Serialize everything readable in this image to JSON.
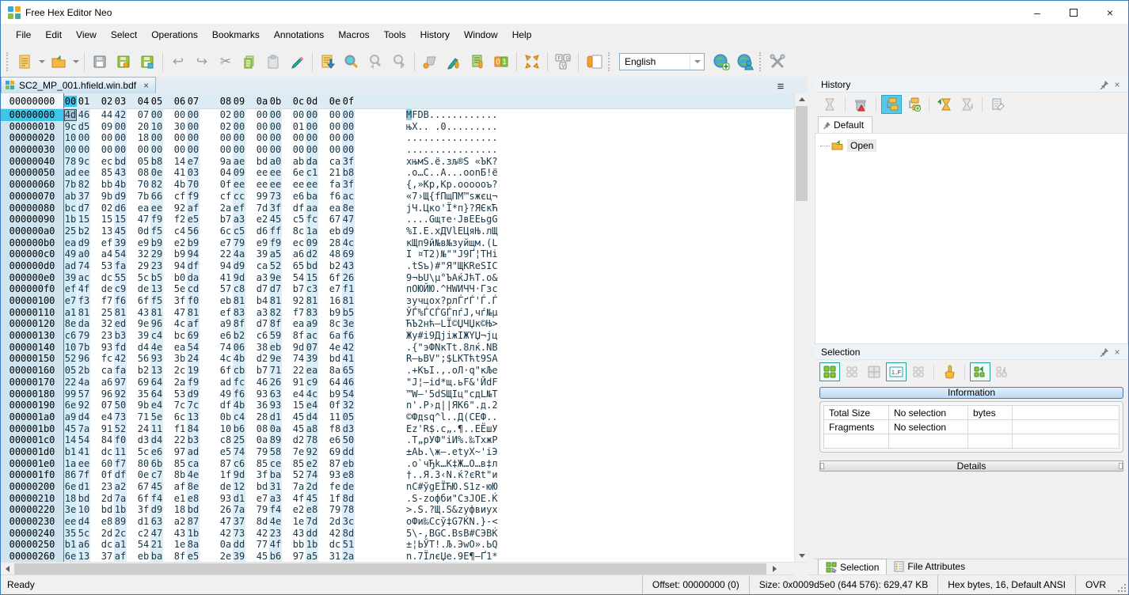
{
  "window": {
    "title": "Free Hex Editor Neo"
  },
  "menu": {
    "items": [
      {
        "label": "File"
      },
      {
        "label": "Edit"
      },
      {
        "label": "View"
      },
      {
        "label": "Select"
      },
      {
        "label": "Operations"
      },
      {
        "label": "Bookmarks"
      },
      {
        "label": "Annotations"
      },
      {
        "label": "Macros"
      },
      {
        "label": "Tools"
      },
      {
        "label": "History"
      },
      {
        "label": "Window"
      },
      {
        "label": "Help"
      }
    ]
  },
  "toolbar": {
    "language": "English"
  },
  "icons": {
    "hamburger": "≡",
    "close": "×",
    "undo": "↩",
    "redo": "↪",
    "cut": "✂",
    "minimize": "–"
  },
  "tab": {
    "title": "SC2_MP_001.hfield.win.bdf"
  },
  "hex": {
    "cursor": {
      "row": 0,
      "col": 0
    },
    "columns": [
      "00",
      "01",
      "02",
      "03",
      "04",
      "05",
      "06",
      "07",
      "08",
      "09",
      "0a",
      "0b",
      "0c",
      "0d",
      "0e",
      "0f"
    ],
    "header_addr": "00000000",
    "rows": [
      {
        "addr": "00000000",
        "bytes": "4d 46 44 42 07 00 00 00 02 00 00 00 00 00 00 00",
        "ascii": "MFDB............"
      },
      {
        "addr": "00000010",
        "bytes": "9c d5 09 00 20 10 30 00 02 00 00 00 01 00 00 00",
        "ascii": "њХ.. .0........."
      },
      {
        "addr": "00000020",
        "bytes": "10 00 00 00 18 00 00 00 00 00 00 00 00 00 00 00",
        "ascii": "................"
      },
      {
        "addr": "00000030",
        "bytes": "00 00 00 00 00 00 00 00 00 00 00 00 00 00 00 00",
        "ascii": "................"
      },
      {
        "addr": "00000040",
        "bytes": "78 9c ec bd 05 b8 14 e7 9a ae bd a0 ab da ca 3f",
        "ascii": "xњмЅ.ё.зљ®Ѕ «ЪК?"
      },
      {
        "addr": "00000050",
        "bytes": "ad ee 85 43 08 0e 41 03 04 09 ee ee 6e c1 21 b8",
        "ascii": ".о…C..A...ооnБ!ё"
      },
      {
        "addr": "00000060",
        "bytes": "7b 82 bb 4b 70 82 4b 70 0f ee ee ee ee ee fa 3f",
        "ascii": "{‚»Kp‚Kp.оооооъ?"
      },
      {
        "addr": "00000070",
        "bytes": "ab 37 9b d9 7b 66 cf f9 cf cc 99 73 e6 ba f6 ac",
        "ascii": "«7›Щ{fПщПМ™sжєц¬"
      },
      {
        "addr": "00000080",
        "bytes": "bc d7 02 d6 ea ee 92 af 2a ef 7d 3f df aa ea 8e",
        "ascii": "јЧ.Цко'Ї*п}?ЯЄкЋ"
      },
      {
        "addr": "00000090",
        "bytes": "1b 15 15 15 47 f9 f2 e5 b7 a3 e2 45 c5 fc 67 47",
        "ascii": "....Gщте·ЈвEЕьgG"
      },
      {
        "addr": "000000a0",
        "bytes": "25 b2 13 45 0d f5 c4 56 6c c5 d6 ff 8c 1a eb d9",
        "ascii": "%І.E.хДVlЕЦяЊ.лЩ"
      },
      {
        "addr": "000000b0",
        "bytes": "ea d9 ef 39 e9 b9 e2 b9 e7 79 e9 f9 ec 09 28 4c",
        "ascii": "кЩп9й№в№зyйщм.(L"
      },
      {
        "addr": "000000c0",
        "bytes": "49 a0 a4 54 32 29 b9 94 22 4a 39 a5 a6 d2 48 69",
        "ascii": "I ¤T2)№\"\"J9Ґ¦ТHi"
      },
      {
        "addr": "000000d0",
        "bytes": "ad 74 53 fa 29 23 94 df 94 d9 ca 52 65 bd b2 43",
        "ascii": ".tSъ)#\"Я\"ЩКReЅІC"
      },
      {
        "addr": "000000e0",
        "bytes": "39 ac dc 55 5c b5 b0 da 41 9d a3 9e 54 15 6f 26",
        "ascii": "9¬ЬU\\µ°ЪAќЈћТ.o&"
      },
      {
        "addr": "000000f0",
        "bytes": "ef 4f de c9 de 13 5e cd 57 c8 d7 d7 b7 c3 e7 f1",
        "ascii": "пОЮЙЮ.^НWИЧЧ·Гзс"
      },
      {
        "addr": "00000100",
        "bytes": "e7 f3 f7 f6 6f f5 3f f0 eb 81 b4 81 92 81 16 81",
        "ascii": "зучцoх?рлЃґЃ'Ѓ.Ѓ"
      },
      {
        "addr": "00000110",
        "bytes": "a1 81 25 81 43 81 47 81 ef 83 a3 82 f7 83 b9 b5",
        "ascii": "ЎЃ%ЃCЃGЃпѓЈ‚чѓ№µ"
      },
      {
        "addr": "00000120",
        "bytes": "8e da 32 ed 9e 96 4c af a9 8f d7 8f ea a9 8c 3e",
        "ascii": "ЋЪ2нћ–LЇ©ЏЧЏк©Њ>"
      },
      {
        "addr": "00000130",
        "bytes": "c6 79 23 b3 39 c4 bc 69 e6 b2 c6 59 8f ac 6a f6",
        "ascii": "Жy#і9ДјiжІЖYЏ¬jц"
      },
      {
        "addr": "00000140",
        "bytes": "10 7b 93 fd d4 4e ea 54 74 06 38 eb 9d 07 4e 42",
        "ascii": ".{\"эФNкTt.8лќ.NB"
      },
      {
        "addr": "00000150",
        "bytes": "52 96 fc 42 56 93 3b 24 4c 4b d2 9e 74 39 bd 41",
        "ascii": "R–ьBV\";$LKТћt9ЅA"
      },
      {
        "addr": "00000160",
        "bytes": "05 2b ca fa b2 13 2c 19 6f cb b7 71 22 ea 8a 65",
        "ascii": ".+КъІ.,.oЛ·q\"кЉe"
      },
      {
        "addr": "00000170",
        "bytes": "22 4a a6 97 69 64 2a f9 ad fc 46 26 91 c9 64 46",
        "ascii": "\"J¦—id*щ.ьF&'ЙdF"
      },
      {
        "addr": "00000180",
        "bytes": "99 57 96 92 35 64 53 d9 49 f6 93 63 e4 4c b9 54",
        "ascii": "™W–'5dSЩIц\"cдL№T"
      },
      {
        "addr": "00000190",
        "bytes": "6e 92 07 50 9b e4 7c 7c df 4b 36 93 15 e4 0f 32",
        "ascii": "n'.P›д||ЯK6\".д.2"
      },
      {
        "addr": "000001a0",
        "bytes": "a9 d4 e4 73 71 5e 6c 13 0b c4 28 d1 45 d4 11 05",
        "ascii": "©Фдsq^l..Д(СEФ.."
      },
      {
        "addr": "000001b0",
        "bytes": "45 7a 91 52 24 11 f1 84 10 b6 08 0a 45 a8 f8 d3",
        "ascii": "Ez'R$.с„.¶..EЁшУ"
      },
      {
        "addr": "000001c0",
        "bytes": "14 54 84 f0 d3 d4 22 b3 c8 25 0a 89 d2 78 e6 50",
        "ascii": ".T„рУФ\"іИ%.‰ТxжP"
      },
      {
        "addr": "000001d0",
        "bytes": "b1 41 dc 11 5c e6 97 ad e5 74 79 58 7e 92 69 dd",
        "ascii": "±AЬ.\\ж—.еtyX~'iЭ"
      },
      {
        "addr": "000001e0",
        "bytes": "1a ee 60 f7 80 6b 85 ca 87 c6 85 ce 85 e2 87 eb",
        "ascii": ".о`чЂk…К‡Ж…О…в‡л"
      },
      {
        "addr": "000001f0",
        "bytes": "86 7f 0f df 0e c7 8b 4e 1f 9d 3f ba 52 74 93 e8",
        "ascii": "†..Я.З‹N.ќ?єRt\"и"
      },
      {
        "addr": "00000200",
        "bytes": "6e d1 23 a2 67 45 af 8e de 12 bd 31 7a 2d fe de",
        "ascii": "nС#ўgEЇЋЮ.Ѕ1z-юЮ"
      },
      {
        "addr": "00000210",
        "bytes": "18 bd 2d 7a 6f f4 e1 e8 93 d1 e7 a3 4f 45 1f 8d",
        "ascii": ".Ѕ-zoфби\"СзЈOE.Ќ"
      },
      {
        "addr": "00000220",
        "bytes": "3e 10 bd 1b 3f d9 18 bd 26 7a 79 f4 e2 e8 79 78",
        "ascii": ">.Ѕ.?Щ.Ѕ&zyфвиyx"
      },
      {
        "addr": "00000230",
        "bytes": "ee d4 e8 89 d1 63 a2 87 47 37 8d 4e 1e 7d 2d 3c",
        "ascii": "оФи‰Сcў‡G7ЌN.}-<"
      },
      {
        "addr": "00000240",
        "bytes": "35 5c 2d 2c c2 47 43 1b 42 73 42 23 43 dd 42 8d",
        "ascii": "5\\-,ВGC.BsB#CЭBЌ"
      },
      {
        "addr": "00000250",
        "bytes": "b1 a6 dc a1 54 21 1e 8a 0a dd 77 4f bb 1b dc 51",
        "ascii": "±¦ЬЎT!.Љ.ЭwO».ЬQ"
      },
      {
        "addr": "00000260",
        "bytes": "6e 13 37 af eb ba 8f e5 2e 39 45 b6 97 a5 31 2a",
        "ascii": "n.7ЇлєЏе.9E¶—Ґ1*"
      }
    ]
  },
  "history": {
    "title": "History",
    "tab_label": "Default",
    "tree_item": "Open"
  },
  "selection": {
    "title": "Selection",
    "information_label": "Information",
    "details_label": "Details",
    "table": {
      "row1": {
        "name": "Total Size",
        "value": "No selection",
        "unit": "bytes"
      },
      "row2": {
        "name": "Fragments",
        "value": "No selection",
        "unit": ""
      }
    },
    "tabs": {
      "selection": "Selection",
      "file_attributes": "File Attributes"
    }
  },
  "statusbar": {
    "ready": "Ready",
    "offset": "Offset: 00000000 (0)",
    "size": "Size: 0x0009d5e0 (644 576): 629,47 KB",
    "format": "Hex bytes, 16, Default ANSI",
    "mode": "OVR"
  }
}
